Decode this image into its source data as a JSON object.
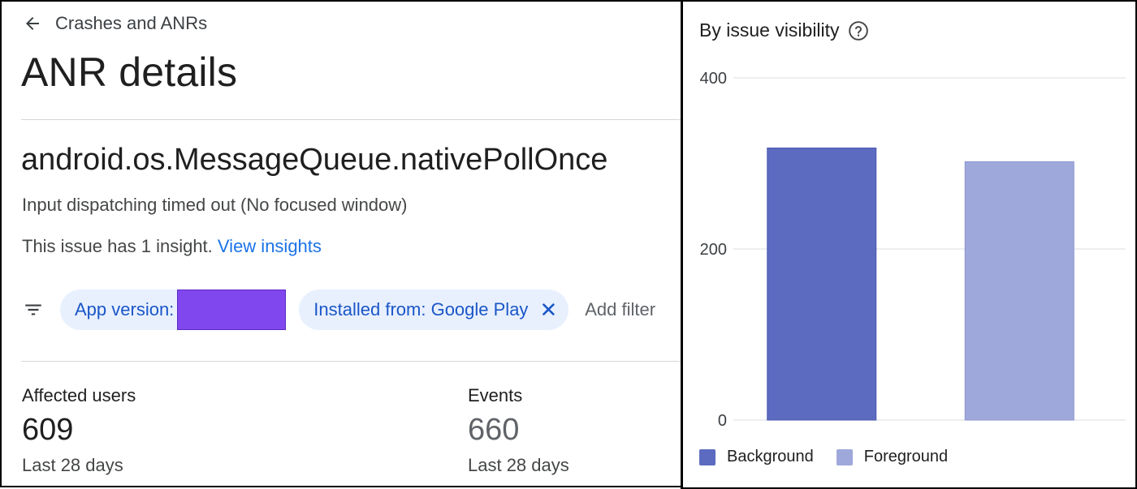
{
  "nav": {
    "back_label": "Crashes and ANRs"
  },
  "page": {
    "title": "ANR details"
  },
  "issue": {
    "title": "android.os.MessageQueue.nativePollOnce",
    "subtitle": "Input dispatching timed out (No focused window)",
    "insight_text": "This issue has 1 insight.",
    "insight_link": "View insights"
  },
  "filters": {
    "chips": [
      {
        "label": "App version:",
        "value_redacted": true
      },
      {
        "label": "Installed from: Google Play",
        "removable": true
      }
    ],
    "add_filter_label": "Add filter",
    "redaction_color": "#8147ee"
  },
  "metrics": {
    "affected_users": {
      "label": "Affected users",
      "value": "609",
      "period": "Last 28 days"
    },
    "events": {
      "label": "Events",
      "value": "660",
      "period": "Last 28 days"
    }
  },
  "chart_panel": {
    "title": "By issue visibility"
  },
  "chart_data": {
    "type": "bar",
    "title": "By issue visibility",
    "categories": [
      "Background",
      "Foreground"
    ],
    "series": [
      {
        "name": "Background",
        "values": [
          318
        ],
        "color": "#5c6bc0"
      },
      {
        "name": "Foreground",
        "values": [
          302
        ],
        "color": "#9fa8da"
      }
    ],
    "values": [
      318,
      302
    ],
    "colors": [
      "#5c6bc0",
      "#9fa8da"
    ],
    "y_ticks": [
      "0",
      "200",
      "400"
    ],
    "ylim": [
      0,
      400
    ],
    "grid": true,
    "legend_placement": "bottom-left"
  },
  "colors": {
    "link": "#1a73e8",
    "chip_bg": "#e8f0fe",
    "chip_text": "#1a56c7"
  },
  "icons": {
    "back": "arrow-left-icon",
    "filter": "filter-list-icon",
    "close": "close-icon",
    "help": "help-circle-icon"
  }
}
